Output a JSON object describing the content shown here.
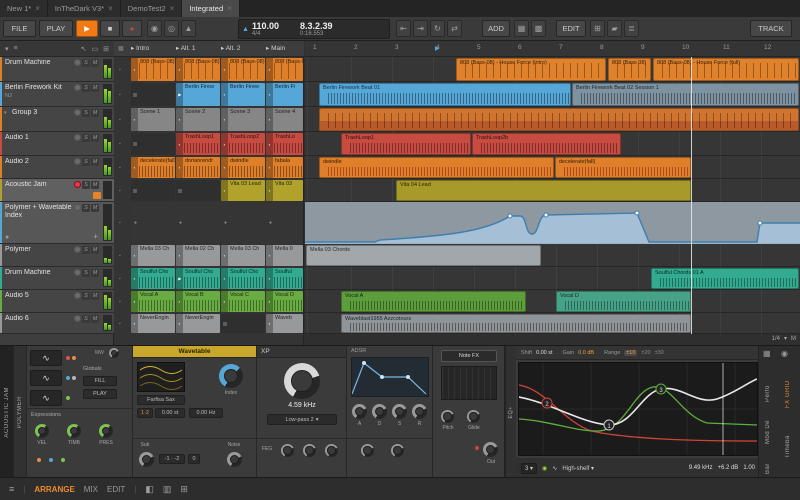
{
  "labels": {
    "s": "S",
    "m": "M"
  },
  "colors": {
    "accent_orange": "#f07d12",
    "meter_green": "#8ec63f",
    "record_red": "#e0403a",
    "clip_blue": "#55a7d7",
    "clip_orange": "#df7f2a",
    "clip_red": "#c74b41",
    "clip_teal": "#32ab90",
    "clip_green": "#69ac41",
    "clip_olive": "#b1a22c"
  },
  "tabs": [
    {
      "label": "New 1*"
    },
    {
      "label": "InTheDark V3*"
    },
    {
      "label": "DemoTest2"
    },
    {
      "label": "Integrated"
    }
  ],
  "transport": {
    "file": "FILE",
    "play": "PLAY",
    "add": "ADD",
    "edit": "EDIT",
    "track": "TRACK",
    "tempo": "110.00",
    "time_sig": "4/4",
    "position": "8.3.2.39",
    "time": "0:16.553"
  },
  "tracks": [
    {
      "name": "Drum Machine"
    },
    {
      "name": "Berlin Firework Kit",
      "sub": "NJ"
    },
    {
      "name": "Group 3"
    },
    {
      "name": "Audio 1"
    },
    {
      "name": "Audio 2"
    },
    {
      "name": "Acoustic Jam"
    },
    {
      "name": "Polymer + Wavetable Index"
    },
    {
      "name": "Polymer"
    },
    {
      "name": "Drum Machine"
    },
    {
      "name": "Audio 5"
    },
    {
      "name": "Audio 6"
    }
  ],
  "launcher": {
    "scenes": [
      "Intro",
      "Alt. 1",
      "Alt. 2",
      "Main"
    ],
    "rows": [
      [
        "808 (Bass-08)",
        "808 (Bass-08)",
        "808 (Bass-08)",
        "808 (Bass-08)"
      ],
      [
        "",
        "Berlin Firew",
        "Berlin Firew",
        "Berlin Fi"
      ],
      [
        "Scene 1",
        "Scene 2",
        "Scene 3",
        "Scene 4"
      ],
      [
        "",
        "TrashLoop1",
        "TrashLoop2",
        "TrashLo"
      ],
      [
        "decelerate(fall)",
        "dorianrendr",
        "dwindle",
        "fabala"
      ],
      [
        "",
        "",
        "Vita 03 Lead",
        "Vita 03"
      ],
      [
        "",
        "",
        "",
        ""
      ],
      [
        "Mella 03 Ch",
        "Mella 02 Ch",
        "Mella 03 Ch",
        "Mella 0"
      ],
      [
        "Soulful Cho",
        "Soulful Cho",
        "Soulful Cho",
        "Soulful"
      ],
      [
        "Vocal A",
        "Vocal B",
        "Vocal C",
        "Vocal D"
      ],
      [
        "NeverEngin",
        "NeverEngin",
        "",
        "Waveb"
      ]
    ]
  },
  "arranger": {
    "ruler": [
      "1",
      "2",
      "3",
      "4",
      "5",
      "6",
      "7",
      "8",
      "9",
      "10",
      "11",
      "12"
    ],
    "snap": "1/4",
    "snap_mode": "M",
    "clips": {
      "r1a": "808 (Bass-08) - House Force (intro)",
      "r1b": "808 (Bass 08)",
      "r1c": "808 (Bass-08) - House Force (full)",
      "r2a": "Berlin Firework Beat 01",
      "r2b": "Berlin Firework Beat 02 Session 1",
      "r4a": "TrashLoop1",
      "r4b": "TrashLoop2b",
      "r5a": "dwindle",
      "r5b": "decelerate(fall)",
      "r6a": "Vita 04 Lead",
      "r8a": "Mella 03 Chords",
      "r9a": "Soulful Chords 01 A",
      "r10a": "Vocal A",
      "r10b": "Vocal D",
      "r11a": "Waveblast1955 Azzcotours"
    }
  },
  "device": {
    "track_label": "ACOUSTIC JAM",
    "polymer": {
      "name": "POLYMER",
      "mw": "MW",
      "globals": "Globals",
      "fill": "FILL",
      "play": "PLAY",
      "expressions": "Expressions",
      "exp1": "VEL",
      "exp2": "TIMB",
      "exp3": "PRES"
    },
    "wavetable": {
      "title": "Wavetable",
      "preset": "Farfisa Sax",
      "index": "Index",
      "unison": "1·2",
      "st": "0.00 st",
      "hz": "0.00 Hz",
      "sub": "Sub",
      "sub_oct": "-1 · -2",
      "sub_val": "0",
      "noise": "Noise"
    },
    "xp": {
      "title": "XP",
      "freq": "4.59 kHz",
      "mode": "Low-pass 2",
      "feg": "FEG"
    },
    "adsr": {
      "title": "ADSR",
      "a": "A",
      "d": "D",
      "s": "S",
      "r": "R"
    },
    "outsec": {
      "notefx": "Note FX",
      "pitch": "Pitch",
      "glide": "Glide",
      "out": "Out"
    },
    "eq": {
      "name": "EQ+",
      "shift_label": "Shift",
      "shift": "0.00 st",
      "gain_label": "Gain",
      "gain": "0.0 dB",
      "range_label": "Range",
      "r1": "±10",
      "r2": "±20",
      "r3": "±30",
      "bands": "3",
      "band_type": "High-shelf",
      "freq": "9.49 kHz",
      "band_gain": "+6.2 dB",
      "q": "1.00",
      "n1": "1",
      "n2": "2",
      "n3": "3"
    },
    "sidebar": {
      "perf": "Perfo",
      "fxgrid": "FX GRID",
      "mod": "Mod De",
      "bar": "Bar",
      "time": "Timeba"
    }
  },
  "statusbar": {
    "arrange": "ARRANGE",
    "mix": "MIX",
    "edit": "EDIT"
  }
}
